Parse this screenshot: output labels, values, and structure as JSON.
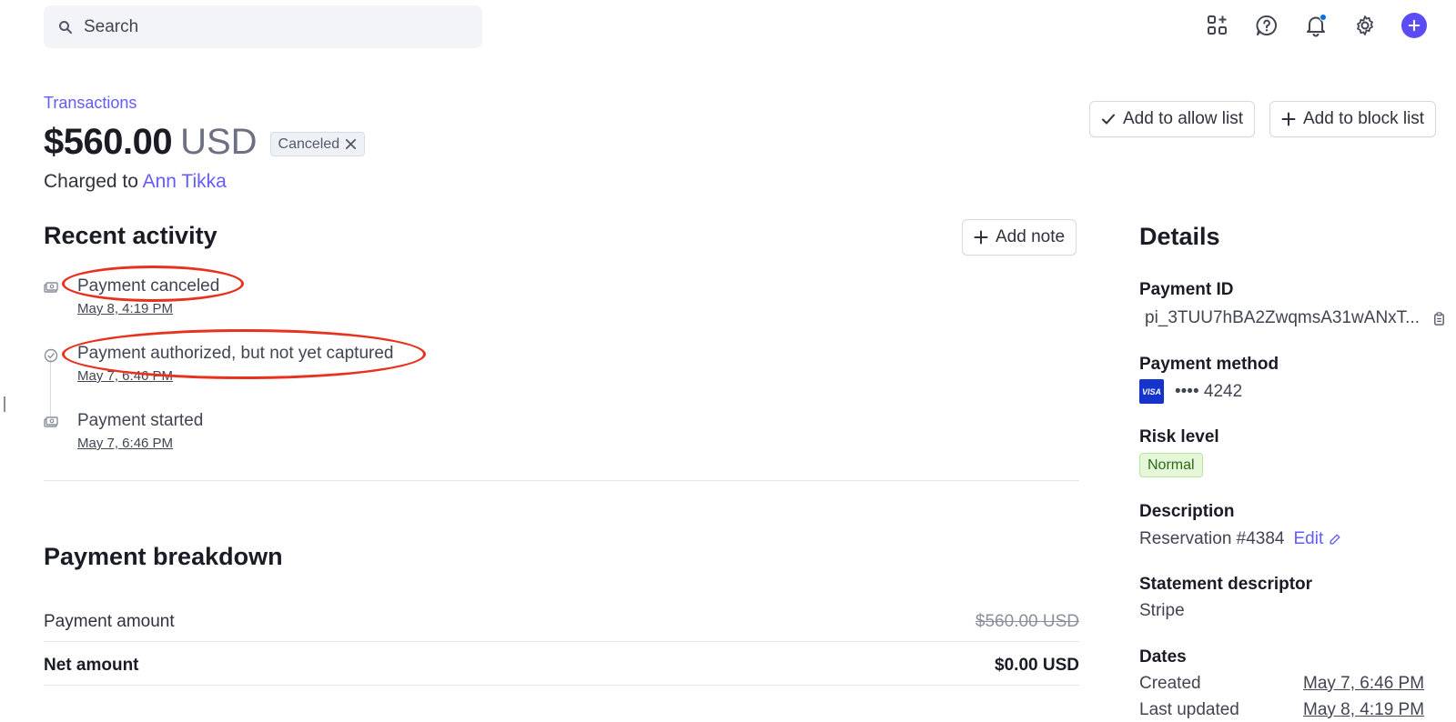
{
  "search": {
    "label": "Search"
  },
  "header": {
    "breadcrumb": "Transactions",
    "amount": "$560.00",
    "currency": "USD",
    "status": "Canceled",
    "charged_prefix": "Charged to",
    "customer": "Ann Tikka"
  },
  "actions": {
    "allow_list": "Add to allow list",
    "block_list": "Add to block list",
    "add_note": "Add note"
  },
  "activity": {
    "title": "Recent activity",
    "items": [
      {
        "title": "Payment canceled",
        "date": "May 8, 4:19 PM",
        "icon": "money-icon",
        "highlighted": true
      },
      {
        "title": "Payment authorized, but not yet captured",
        "date": "May 7, 6:46 PM",
        "icon": "check-circle-icon",
        "highlighted": true
      },
      {
        "title": "Payment started",
        "date": "May 7, 6:46 PM",
        "icon": "money-icon",
        "highlighted": false
      }
    ]
  },
  "breakdown": {
    "title": "Payment breakdown",
    "rows": [
      {
        "label": "Payment amount",
        "value": "$560.00 USD"
      },
      {
        "label": "Net amount",
        "value": "$0.00 USD"
      }
    ]
  },
  "details": {
    "title": "Details",
    "payment_id_label": "Payment ID",
    "payment_id": "pi_3TUU7hBA2ZwqmsA31wANxT...",
    "payment_method_label": "Payment method",
    "card_brand": "VISA",
    "card_last4": "•••• 4242",
    "risk_label": "Risk level",
    "risk_value": "Normal",
    "description_label": "Description",
    "description": "Reservation #4384",
    "edit": "Edit",
    "descriptor_label": "Statement descriptor",
    "descriptor": "Stripe",
    "dates_label": "Dates",
    "created_label": "Created",
    "created": "May 7, 6:46 PM",
    "updated_label": "Last updated",
    "updated": "May 8, 4:19 PM"
  },
  "colors": {
    "accent": "#635bff",
    "annotation": "#e8311e",
    "risk_normal_bg": "#e6f7d9",
    "visa": "#1434cb"
  }
}
